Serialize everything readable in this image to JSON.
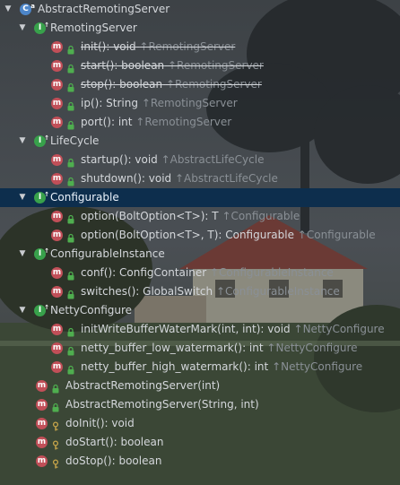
{
  "root": {
    "label": "AbstractRemotingServer",
    "icon": "class-icon"
  },
  "groups": [
    {
      "name": "RemotingServer",
      "items": [
        {
          "sig": "init(): void",
          "from": "↑RemotingServer",
          "strike": true
        },
        {
          "sig": "start(): boolean",
          "from": "↑RemotingServer",
          "strike": true
        },
        {
          "sig": "stop(): boolean",
          "from": "↑RemotingServer",
          "strike": true
        },
        {
          "sig": "ip(): String",
          "from": "↑RemotingServer",
          "strike": false
        },
        {
          "sig": "port(): int",
          "from": "↑RemotingServer",
          "strike": false
        }
      ]
    },
    {
      "name": "LifeCycle",
      "items": [
        {
          "sig": "startup(): void",
          "from": "↑AbstractLifeCycle"
        },
        {
          "sig": "shutdown(): void",
          "from": "↑AbstractLifeCycle"
        }
      ]
    },
    {
      "name": "Configurable",
      "selected": true,
      "items": [
        {
          "sig": "option(BoltOption<T>): T",
          "from": "↑Configurable"
        },
        {
          "sig": "option(BoltOption<T>, T): Configurable",
          "from": "↑Configurable"
        }
      ]
    },
    {
      "name": "ConfigurableInstance",
      "items": [
        {
          "sig": "conf(): ConfigContainer",
          "from": "↑ConfigurableInstance"
        },
        {
          "sig": "switches(): GlobalSwitch",
          "from": "↑ConfigurableInstance"
        }
      ]
    },
    {
      "name": "NettyConfigure",
      "items": [
        {
          "sig": "initWriteBufferWaterMark(int, int): void",
          "from": "↑NettyConfigure"
        },
        {
          "sig": "netty_buffer_low_watermark(): int",
          "from": "↑NettyConfigure"
        },
        {
          "sig": "netty_buffer_high_watermark(): int",
          "from": "↑NettyConfigure"
        }
      ]
    }
  ],
  "own_members": [
    {
      "sig": "AbstractRemotingServer(int)",
      "visibility": "public"
    },
    {
      "sig": "AbstractRemotingServer(String, int)",
      "visibility": "public"
    },
    {
      "sig": "doInit(): void",
      "visibility": "protected"
    },
    {
      "sig": "doStart(): boolean",
      "visibility": "protected"
    },
    {
      "sig": "doStop(): boolean",
      "visibility": "protected"
    }
  ],
  "icons": {
    "class": "C",
    "interface": "I",
    "method": "m",
    "abstract_marker": "a",
    "inherited_marker": "↑"
  },
  "colors": {
    "selection": "#0d2e4d",
    "method_icon": "#c14f58",
    "interface_icon": "#38a14b",
    "class_icon": "#4d86c9",
    "inherited_text": "#8a9096",
    "public_lock": "#4fae4f",
    "protected_key": "#c8a64a"
  }
}
